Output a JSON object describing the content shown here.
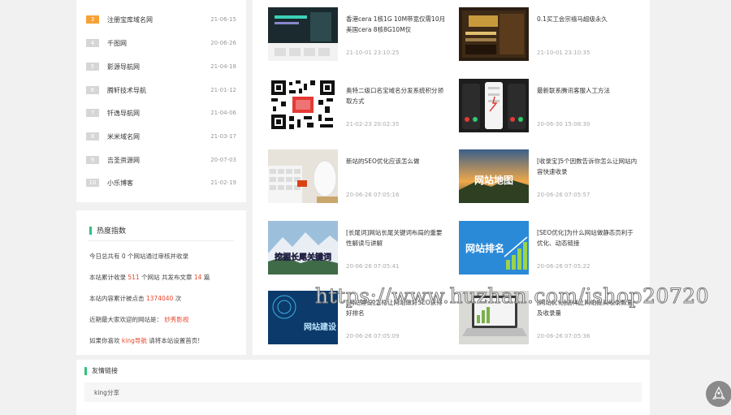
{
  "rank_list": [
    {
      "num": "3",
      "title": "注册宝库域名网",
      "date": "21-06-15"
    },
    {
      "num": "4",
      "title": "千图网",
      "date": "20-06-26"
    },
    {
      "num": "5",
      "title": "影源导航网",
      "date": "21-04-18"
    },
    {
      "num": "6",
      "title": "腾轩技术导航",
      "date": "21-01-12"
    },
    {
      "num": "7",
      "title": "钎逸导航网",
      "date": "21-04-06"
    },
    {
      "num": "8",
      "title": "米米域名网",
      "date": "21-03-17"
    },
    {
      "num": "9",
      "title": "吉圣资源网",
      "date": "20-07-03"
    },
    {
      "num": "10",
      "title": "小乐博客",
      "date": "21-02-19"
    }
  ],
  "heat": {
    "title": "热度指数",
    "line1": "今日总共有 0 个网站通过审核并收录",
    "line2_prefix": "本站累计收录",
    "line2_sites": "511",
    "line2_mid": "个网站 共发布文章",
    "line2_articles": "14",
    "line2_suffix": "篇",
    "line3_prefix": "本站内容累计被点击",
    "line3_clicks": "1374040",
    "line3_suffix": "次",
    "line4_prefix": "近期最大家欢迎的网站是：",
    "line4_site": "妙秀影视",
    "line5_prefix": "如果你喜欢",
    "line5_site": "king导航",
    "line5_suffix": "请将本站设置首页!"
  },
  "articles": [
    {
      "title": "香港cera 1核1G 10M带宽仅需10月 美国cera 8核8G10M仅",
      "date": "21-10-01 23:10:25"
    },
    {
      "title": "0.1买工会宗禧马超级永久",
      "date": "21-10-01 23:10:35"
    },
    {
      "title": "奥特二级口名宝域名分发系统积分领取方式",
      "date": "21-02-23 20:02:35"
    },
    {
      "title": "最新联系腾讯客服人工方法",
      "date": "20-06-30 15:08:30"
    },
    {
      "title": "新站的SEO优化应该怎么做",
      "date": "20-06-26 07:05:16"
    },
    {
      "title": "[收录宝]5个因数告诉你怎么让网站内容快速收录",
      "date": "20-06-26 07:05:57"
    },
    {
      "title": "[长尾词]网站长尾关键词布局的重要性解读与讲解",
      "date": "20-06-26 07:05:41"
    },
    {
      "title": "[SEO优化]为什么网站做静态页利于优化、动态链接",
      "date": "20-06-26 07:05:22"
    },
    {
      "title": "[网站建设]怎样让网站做好SEO获得好排名",
      "date": "20-06-26 07:05:09"
    },
    {
      "title": "[网站优化]怎样让网站提高收录数量及收录量",
      "date": "20-06-26 07:05:36"
    }
  ],
  "links": {
    "title": "友情链接",
    "item": "king分享"
  },
  "watermark": "https://www.huzhan.com/ishop20720",
  "thumbs": {
    "t6": "网站地图",
    "t7": "挖掘长尾关键词",
    "t8": "网站排名",
    "t9": "网站建设"
  }
}
